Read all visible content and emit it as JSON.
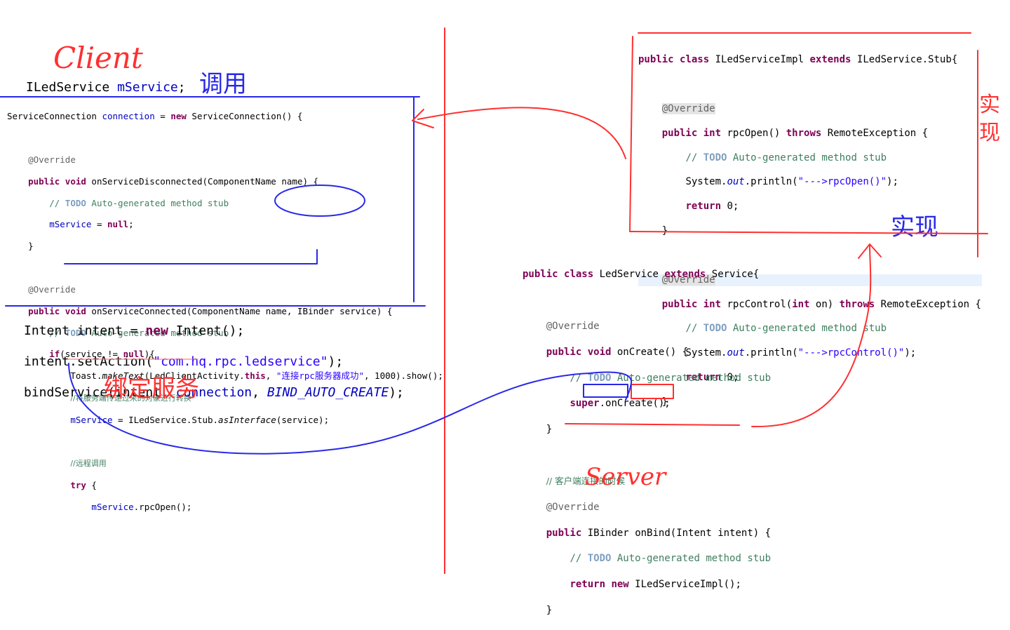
{
  "client": {
    "handwritten_label": "Client",
    "handwritten_call_label": "调用",
    "handwritten_bind_label": "绑定服务",
    "field_decl": {
      "type": "ILedService",
      "name": "mService"
    },
    "connection_line": {
      "prefix": "ServiceConnection ",
      "var": "connection",
      "mid": " = ",
      "kw": "new",
      "suffix": " ServiceConnection() {"
    },
    "override": "@Override",
    "disconnected_sig": {
      "kw1": "public",
      "kw2": "void",
      "rest": " onServiceDisconnected(ComponentName name) {"
    },
    "todo_comment": {
      "prefix": "// ",
      "todo": "TODO",
      "rest": " Auto-generated method stub"
    },
    "mservice_null": {
      "field": "mService",
      "mid": " = ",
      "kw": "null",
      "end": ";"
    },
    "close_brace": "}",
    "connected_sig": {
      "kw1": "public",
      "kw2": "void",
      "rest": " onServiceConnected(ComponentName name, IBinder service) {"
    },
    "if_line": {
      "kw": "if",
      "mid": "(service != ",
      "kw2": "null",
      "end": "){"
    },
    "toast_line": {
      "pre": "Toast.",
      "method": "makeText",
      "mid": "(LedClientActivity.",
      "kw": "this",
      "sep": ", ",
      "str": "\"连接rpc服务器成功\"",
      "end": ", 1000).show();"
    },
    "cn_comment_convert": "//将服务端传递过来的对象进行转换",
    "asinterface_line": {
      "field": "mService",
      "mid": " = ILedService.Stub.",
      "method": "asInterface",
      "end": "(service);"
    },
    "cn_comment_remote": "//远程调用",
    "try_line": {
      "kw": "try",
      "end": " {"
    },
    "rpcopen_line": {
      "field": "mService",
      "end": ".rpcOpen();"
    },
    "intent_line": {
      "pre": "Intent intent = ",
      "kw": "new",
      "end": " Intent();"
    },
    "setaction_line": {
      "pre": "intent.setAction(",
      "str": "\"com.hq.rpc.ledservice\"",
      "end": ");"
    },
    "bind_line": {
      "pre": "bindService(intent, ",
      "var": "connection",
      "sep": ", ",
      "const": "BIND_AUTO_CREATE",
      "end": ");"
    }
  },
  "impl": {
    "handwritten_label": "实现",
    "handwritten_side_label": "实现",
    "class_line": {
      "kw1": "public",
      "kw2": "class",
      "name": " ILedServiceImpl ",
      "kw3": "extends",
      "rest": " ILedService.Stub{"
    },
    "override": "@Override",
    "rpcopen_sig": {
      "kw1": "public",
      "kw2": "int",
      "mid": " rpcOpen() ",
      "kw3": "throws",
      "rest": " RemoteException {"
    },
    "todo_comment": {
      "prefix": "// ",
      "todo": "TODO",
      "rest": " Auto-generated method stub"
    },
    "println_open": {
      "pre": "System.",
      "out": "out",
      "mid": ".println(",
      "str": "\"--->rpcOpen()\"",
      "end": ");"
    },
    "return0": {
      "kw": "return",
      "end": " 0;"
    },
    "close_brace": "}",
    "rpccontrol_sig": {
      "kw1": "public",
      "kw2": "int",
      "mid": " rpcControl(",
      "kw3": "int",
      "mid2": " on) ",
      "kw4": "throws",
      "rest": " RemoteException {"
    },
    "println_control": {
      "pre": "System.",
      "out": "out",
      "mid": ".println(",
      "str": "\"--->rpcControl()\"",
      "end": ");"
    }
  },
  "service": {
    "handwritten_label": "Server",
    "class_line": {
      "kw1": "public",
      "kw2": "class",
      "name": " LedService ",
      "kw3": "extends",
      "rest": " Service{"
    },
    "override": "@Override",
    "oncreate_sig": {
      "kw1": "public",
      "kw2": "void",
      "rest": " onCreate() {"
    },
    "todo_comment": {
      "prefix": "// ",
      "todo": "TODO",
      "rest": " Auto-generated method stub"
    },
    "super_line": {
      "kw": "super",
      "end": ".onCreate();"
    },
    "close_brace": "}",
    "cn_comment_connect": "// 客户端连接的时候",
    "onbind_sig": {
      "kw": "public",
      "sp": " ",
      "type": "IBinder",
      "sp2": " ",
      "name": "onBind",
      "rest": "(Intent intent) {"
    },
    "return_line": {
      "kw1": "return",
      "sp": " ",
      "kw2": "new",
      "rest": " ILedServiceImpl();"
    }
  },
  "colors": {
    "red_ink": "#ff3030",
    "blue_ink": "#2828e8"
  }
}
